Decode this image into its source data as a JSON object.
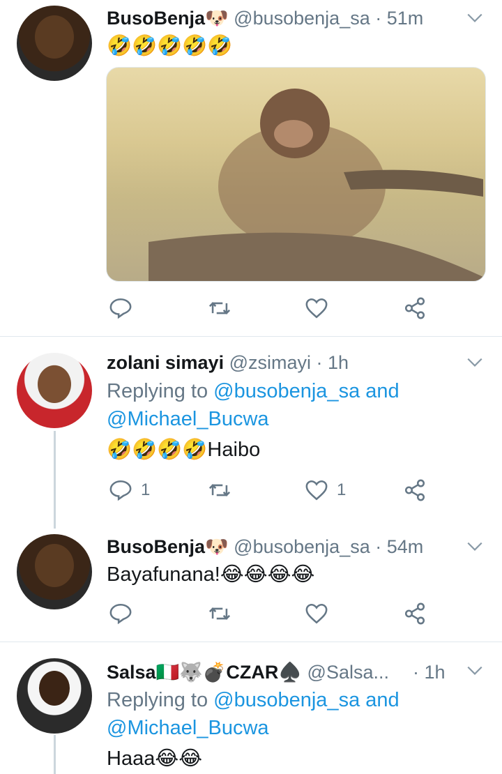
{
  "tweets": [
    {
      "name": "BusoBenja🐶",
      "handle": "@busobenja_sa",
      "time": "51m",
      "text": "🤣🤣🤣🤣🤣",
      "has_media": true,
      "replies": "",
      "likes": ""
    },
    {
      "name": "zolani simayi",
      "handle": "@zsimayi",
      "time": "1h",
      "reply_prefix": "Replying to ",
      "reply_user1": "@busobenja_sa",
      "reply_and": " and",
      "reply_user2": "@Michael_Bucwa",
      "text": "🤣🤣🤣🤣Haibo",
      "replies": "1",
      "likes": "1"
    },
    {
      "name": "BusoBenja🐶",
      "handle": "@busobenja_sa",
      "time": "54m",
      "text": "Bayafunana!😂😂😂😂",
      "replies": "",
      "likes": ""
    },
    {
      "name": "Salsa🇮🇹🐺💣CZAR♠️",
      "handle": "@Salsa...",
      "time": "1h",
      "reply_prefix": "Replying to ",
      "reply_user1": "@busobenja_sa",
      "reply_and": " and",
      "reply_user2": "@Michael_Bucwa",
      "text": "Haaa😂😂"
    }
  ],
  "separator": " · ",
  "colors": {
    "link": "#1b95e0",
    "secondary": "#657786",
    "divider": "#e1e8ed"
  },
  "icons": [
    "reply-icon",
    "retweet-icon",
    "like-icon",
    "share-icon",
    "chevron-down-icon"
  ]
}
